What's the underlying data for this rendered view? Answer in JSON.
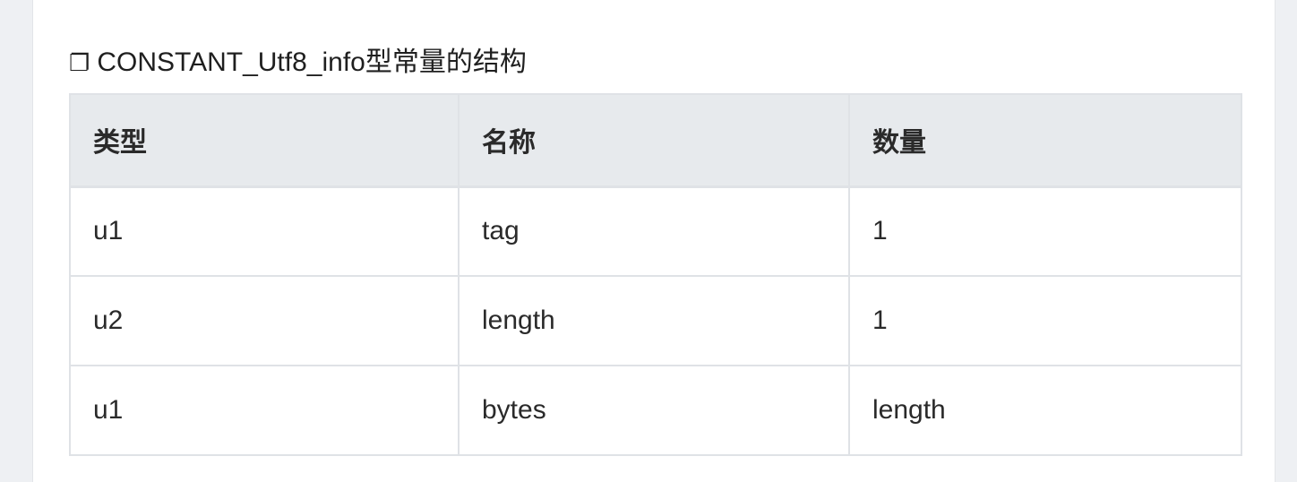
{
  "heading": {
    "icon": "square-bullet-icon",
    "glyph": "❐",
    "title": "CONSTANT_Utf8_info型常量的结构"
  },
  "table": {
    "headers": [
      "类型",
      "名称",
      "数量"
    ],
    "rows": [
      [
        "u1",
        "tag",
        "1"
      ],
      [
        "u2",
        "length",
        "1"
      ],
      [
        "u1",
        "bytes",
        "length"
      ]
    ]
  }
}
